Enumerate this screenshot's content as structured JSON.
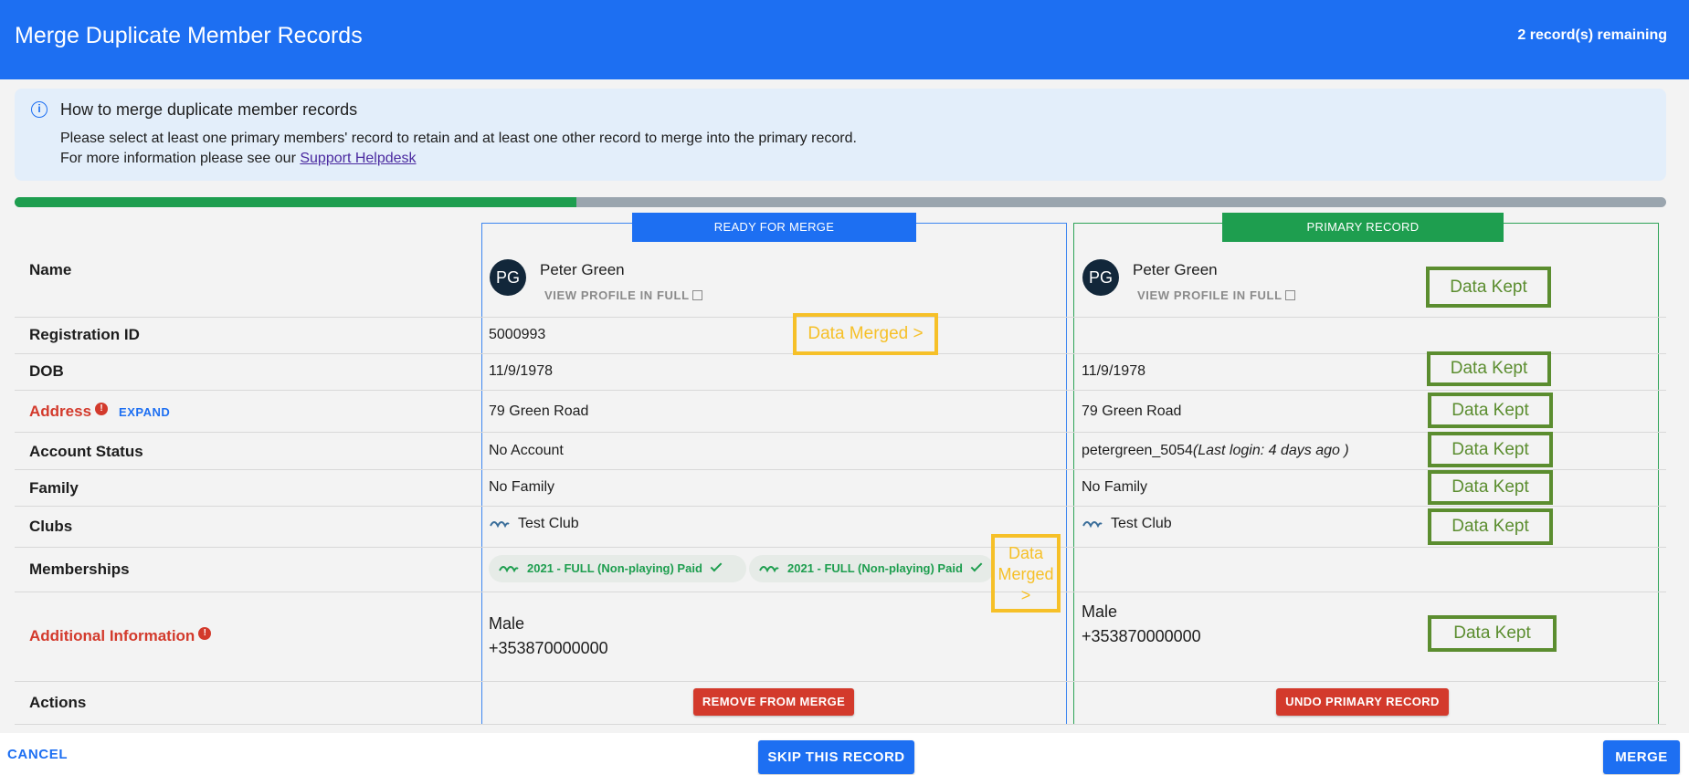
{
  "header": {
    "title": "Merge Duplicate Member Records",
    "remaining": "2 record(s) remaining"
  },
  "info": {
    "heading": "How to merge duplicate member records",
    "line1": "Please select at least one primary members' record to retain and at least one other record to merge into the primary record.",
    "line2_prefix": "For more information please see our ",
    "link": "Support Helpdesk"
  },
  "progress": {
    "fraction": 0.34
  },
  "rows": {
    "name": "Name",
    "registration_id": "Registration ID",
    "dob": "DOB",
    "address": "Address",
    "address_expand": "EXPAND",
    "account_status": "Account Status",
    "family": "Family",
    "clubs": "Clubs",
    "memberships": "Memberships",
    "additional_info": "Additional Information",
    "actions": "Actions"
  },
  "merge_record": {
    "header": "READY FOR MERGE",
    "avatar": "PG",
    "name": "Peter Green",
    "view_profile": "VIEW PROFILE IN FULL",
    "registration_id": "5000993",
    "dob": "11/9/1978",
    "address": "79 Green Road",
    "account_status": "No Account",
    "family": "No Family",
    "club": "Test Club",
    "memberships": [
      "2021 - FULL (Non-playing) Paid",
      "2021 - FULL (Non-playing) Paid"
    ],
    "gender": "Male",
    "phone": "+353870000000",
    "action": "REMOVE FROM MERGE"
  },
  "primary_record": {
    "header": "PRIMARY RECORD",
    "avatar": "PG",
    "name": "Peter Green",
    "view_profile": "VIEW PROFILE IN FULL",
    "dob": "11/9/1978",
    "address": "79 Green Road",
    "account_username": "petergreen_5054",
    "account_login": "(Last login: 4 days ago )",
    "family": "No Family",
    "club": "Test Club",
    "gender": "Male",
    "phone": "+353870000000",
    "action": "UNDO PRIMARY RECORD"
  },
  "annotations": {
    "data_merged": "Data Merged >",
    "data_merged_small_1": "Data",
    "data_merged_small_2": "Merged",
    "data_merged_small_3": ">",
    "data_kept": "Data Kept"
  },
  "footer": {
    "cancel": "CANCEL",
    "skip": "SKIP THIS RECORD",
    "merge": "MERGE"
  },
  "colors": {
    "blue": "#1d6ff2",
    "green": "#1e9e4f",
    "red": "#d33a2c",
    "yellow": "#f6c028",
    "olive": "#5b8d2f"
  }
}
